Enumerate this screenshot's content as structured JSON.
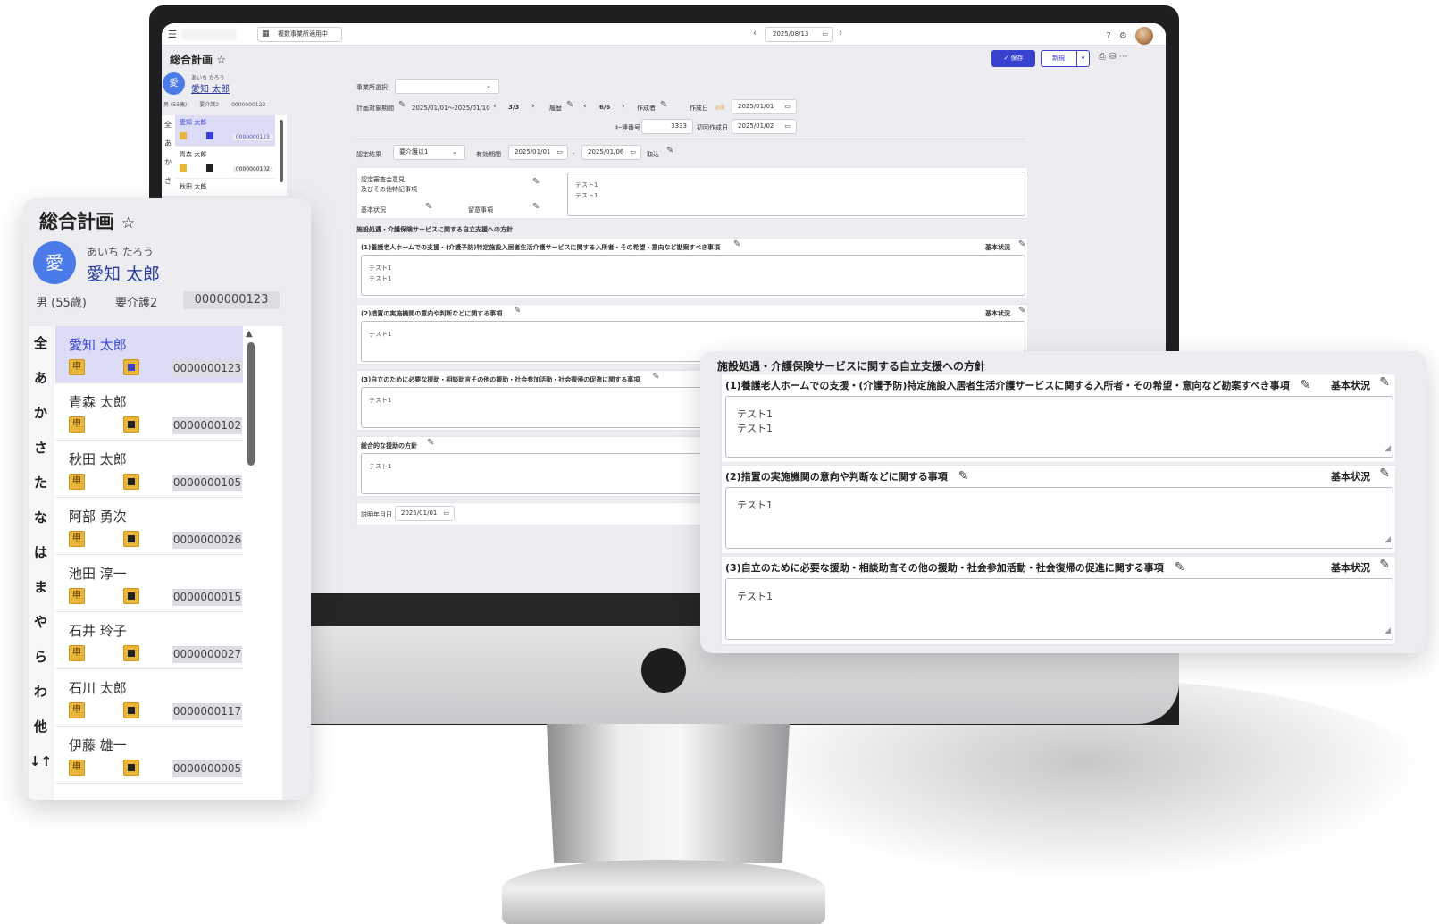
{
  "header": {
    "office_chip": "複数事業所適用中",
    "current_date": "2025/08/13",
    "page_title": "総合計画",
    "save_label": "保存",
    "new_label": "新規"
  },
  "patient": {
    "initial": "愛",
    "kana": "あいち たろう",
    "name": "愛知 太郎",
    "gender_age": "男 (55歳)",
    "care_level": "要介護2",
    "id": "0000000123",
    "mini_gender": "男 (55歳)"
  },
  "index_letters": [
    "全",
    "あ",
    "か",
    "さ",
    "た",
    "な",
    "は",
    "ま",
    "や",
    "ら",
    "わ",
    "他",
    "↓↑"
  ],
  "mini_index": [
    "全",
    "あ",
    "か",
    "さ"
  ],
  "patient_list": [
    {
      "name": "愛知 太郎",
      "tag": "申",
      "id": "0000000123"
    },
    {
      "name": "青森 太郎",
      "tag": "申",
      "id": "0000000102"
    },
    {
      "name": "秋田 太郎",
      "tag": "申",
      "id": "0000000105"
    },
    {
      "name": "阿部 勇次",
      "tag": "申",
      "id": "0000000026"
    },
    {
      "name": "池田 淳一",
      "tag": "申",
      "id": "0000000015"
    },
    {
      "name": "石井 玲子",
      "tag": "申",
      "id": "0000000027"
    },
    {
      "name": "石川 太郎",
      "tag": "申",
      "id": "0000000117"
    },
    {
      "name": "伊藤 雄一",
      "tag": "申",
      "id": "0000000005"
    }
  ],
  "form": {
    "office_select_label": "事業所選択",
    "period_label": "計画対象期間",
    "period_value": "2025/01/01～2025/01/10",
    "page_a": "3/3",
    "history_label": "履歴",
    "page_b": "6/6",
    "author_label": "作成者",
    "created_label": "作成日",
    "required": "必須",
    "created_value": "2025/01/01",
    "seq_label": "ｷｰ連番号",
    "seq_value": "3333",
    "first_created_label": "初回作成日",
    "first_created_value": "2025/01/02",
    "cert_result_label": "認定結果",
    "cert_result_value": "要介護以1",
    "valid_period_label": "有効期間",
    "valid_from": "2025/01/01",
    "valid_sep": "-",
    "valid_to": "2025/01/06",
    "import_label": "取込",
    "opinion_label_1": "認定審査会意見、",
    "opinion_label_2": "及びその他特記事項",
    "basic_status": "基本状況",
    "notes_label": "留意事項",
    "opinion_text_1": "テスト1",
    "opinion_text_2": "テスト1",
    "section_heading": "施設処遇・介護保険サービスに関する自立支援への方針",
    "item1": "(1)養護老人ホームでの支援・(介護予防)特定施設入居者生活介護サービスに関する入所者・その希望・意向など勘案すべき事項",
    "item2": "(2)措置の実施機関の意向や判断などに関する事項",
    "item3": "(3)自立のために必要な援助・相談助言その他の援助・社会参加活動・社会復帰の促進に関する事項",
    "item4": "総合的な援助の方針",
    "test_text": "テスト1",
    "explain_date_label": "説明年月日",
    "explain_date_value": "2025/01/01"
  },
  "zoom": {
    "heading": "施設処遇・介護保険サービスに関する自立支援への方針",
    "item1": "(1)養護老人ホームでの支援・(介護予防)特定施設入居者生活介護サービスに関する入所者・その希望・意向など勘案すべき事項",
    "item2": "(2)措置の実施機関の意向や判断などに関する事項",
    "item3": "(3)自立のために必要な援助・相談助言その他の援助・社会参加活動・社会復帰の促進に関する事項",
    "basic_status": "基本状況",
    "text_line": "テスト1"
  }
}
